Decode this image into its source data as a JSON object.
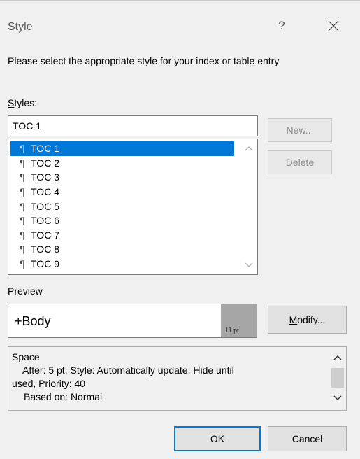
{
  "dialog": {
    "title": "Style",
    "help_label": "?",
    "close_icon": "close-icon"
  },
  "instruction": "Please select the appropriate style for your index or table entry",
  "styles": {
    "label_access_key": "S",
    "label_rest": "tyles:",
    "input_value": "TOC 1",
    "items": [
      {
        "label": "TOC 1",
        "selected": true
      },
      {
        "label": "TOC 2",
        "selected": false
      },
      {
        "label": "TOC 3",
        "selected": false
      },
      {
        "label": "TOC 4",
        "selected": false
      },
      {
        "label": "TOC 5",
        "selected": false
      },
      {
        "label": "TOC 6",
        "selected": false
      },
      {
        "label": "TOC 7",
        "selected": false
      },
      {
        "label": "TOC 8",
        "selected": false
      },
      {
        "label": "TOC 9",
        "selected": false
      }
    ],
    "item_icon": "¶"
  },
  "buttons": {
    "new": "New...",
    "delete": "Delete",
    "modify_access_key": "M",
    "modify_rest": "odify...",
    "ok": "OK",
    "cancel": "Cancel"
  },
  "preview": {
    "label": "Preview",
    "text": "+Body",
    "size": "11 pt"
  },
  "description": {
    "line1": "Space",
    "line2": "After:  5 pt, Style: Automatically update, Hide until",
    "line3": "used, Priority: 40",
    "line4": "Based on: Normal"
  },
  "colors": {
    "selection": "#0078d7",
    "default_button_border": "#0078d7",
    "dialog_background": "#f0f0f0"
  }
}
